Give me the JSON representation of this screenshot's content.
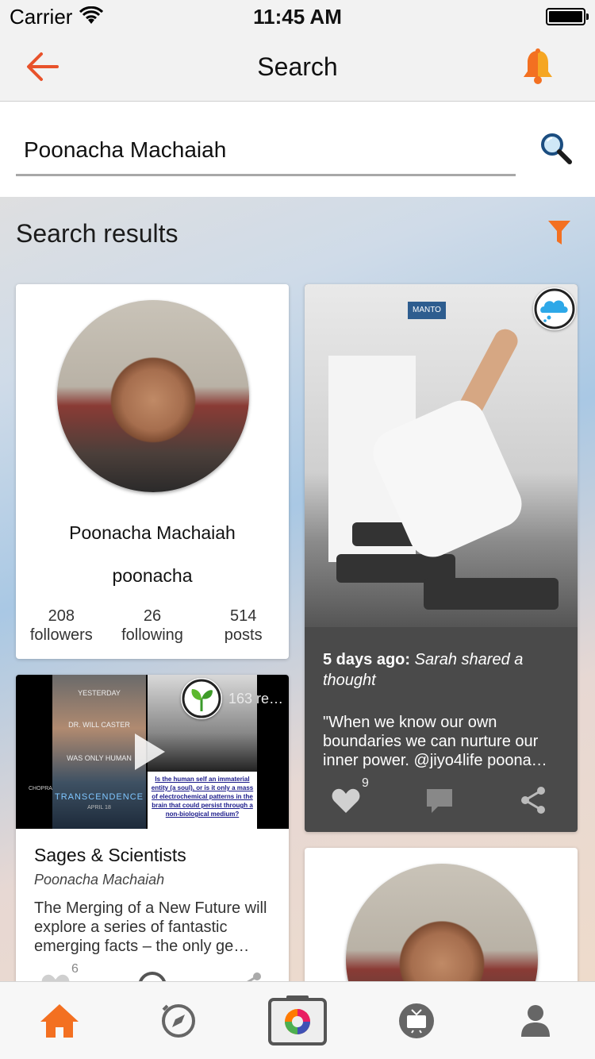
{
  "status": {
    "carrier": "Carrier",
    "time": "11:45 AM"
  },
  "nav": {
    "title": "Search"
  },
  "search": {
    "value": "Poonacha Machaiah",
    "placeholder": ""
  },
  "results_title": "Search results",
  "profile": {
    "name": "Poonacha Machaiah",
    "handle": "poonacha",
    "stats": [
      {
        "value": "208",
        "label": "followers"
      },
      {
        "value": "26",
        "label": "following"
      },
      {
        "value": "514",
        "label": "posts"
      }
    ]
  },
  "thought": {
    "time": "5 days ago:",
    "summary": "Sarah shared a thought",
    "quote": "\"When we know our own boundaries we can nurture our inner power. @jiyo4life poona…",
    "likes": "9",
    "photo_sign": "MANTO"
  },
  "video": {
    "views": "163 re…",
    "title": "Sages & Scientists",
    "author": "Poonacha Machaiah",
    "description": "The Merging of a New Future will explore a series of fantastic emerging facts – the only ge…",
    "likes": "6",
    "poster": {
      "line1": "YESTERDAY",
      "line2": "DR. WILL CASTER",
      "line3": "WAS ONLY HUMAN",
      "title": "TRANSCENDENCE",
      "date": "APRIL 18"
    },
    "caption": "Is the human self an immaterial entity (a soul), or is it only a mass of electrochemical patterns in the brain that could persist through a non-biological medium?",
    "logo": "CHOPRA FOUNDA"
  },
  "icons": {
    "back": "arrow-left-icon",
    "bell": "bell-icon",
    "search": "magnifier-icon",
    "filter": "filter-icon",
    "tabs": [
      "home-icon",
      "compass-icon",
      "camera-icon",
      "tv-icon",
      "profile-icon"
    ]
  },
  "colors": {
    "accent": "#F37021",
    "bell": "#F5A623",
    "card_dark": "#4A4A4A"
  }
}
